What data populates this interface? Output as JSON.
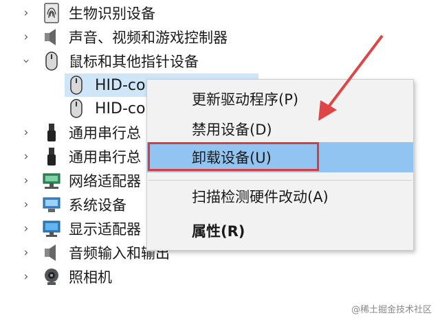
{
  "tree": {
    "items": [
      {
        "label": "生物识别设备",
        "icon": "fingerprint-icon",
        "expanded": false
      },
      {
        "label": "声音、视频和游戏控制器",
        "icon": "speaker-icon",
        "expanded": false
      },
      {
        "label": "鼠标和其他指针设备",
        "icon": "mouse-icon",
        "expanded": true
      },
      {
        "label": "HID-co",
        "icon": "mouse-icon",
        "child": true,
        "selected": true
      },
      {
        "label": "HID-co",
        "icon": "mouse-icon",
        "child": true
      },
      {
        "label": "通用串行总",
        "icon": "usb-icon",
        "expanded": false
      },
      {
        "label": "通用串行总",
        "icon": "usb-icon",
        "expanded": false
      },
      {
        "label": "网络适配器",
        "icon": "network-icon",
        "expanded": false
      },
      {
        "label": "系统设备",
        "icon": "system-icon",
        "expanded": false
      },
      {
        "label": "显示适配器",
        "icon": "display-icon",
        "expanded": false
      },
      {
        "label": "音频输入和输出",
        "icon": "speaker-icon",
        "expanded": false
      },
      {
        "label": "照相机",
        "icon": "camera-icon",
        "expanded": false
      }
    ]
  },
  "context_menu": {
    "items": [
      {
        "label": "更新驱动程序(P)"
      },
      {
        "label": "禁用设备(D)"
      },
      {
        "label": "卸载设备(U)",
        "highlighted": true
      },
      {
        "label": "扫描检测硬件改动(A)"
      },
      {
        "label": "属性(R)",
        "bold": true
      }
    ]
  },
  "colors": {
    "highlight": "#92c4f2",
    "annotation_red": "#d93a3a",
    "selected_row": "#cfe6f8"
  },
  "watermark": "@稀土掘金技术社区"
}
